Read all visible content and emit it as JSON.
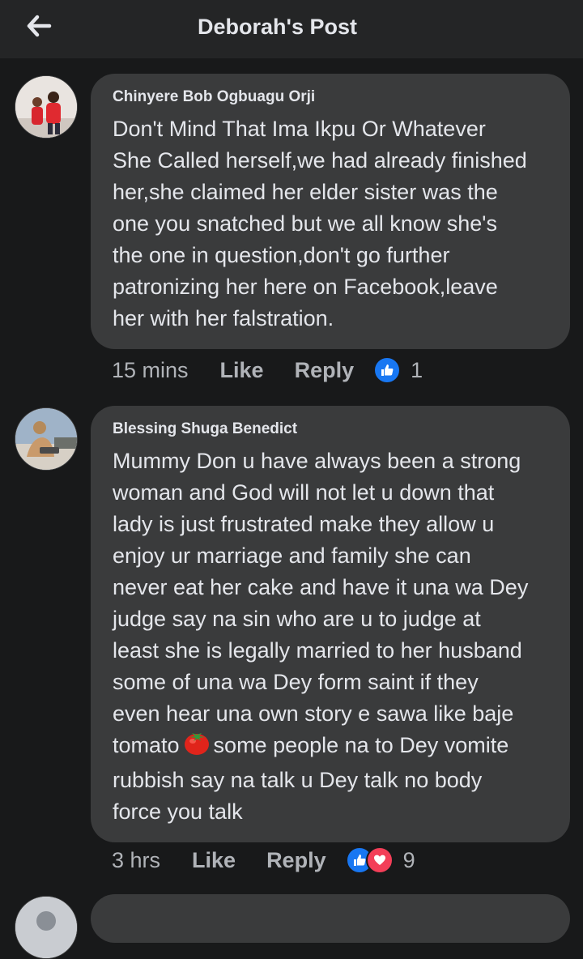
{
  "header": {
    "title": "Deborah's Post",
    "back_icon": "arrow-left-icon"
  },
  "colors": {
    "background": "#18191a",
    "bubble": "#3a3b3c",
    "like_blue": "#1877f2",
    "love_red": "#f33e58"
  },
  "comments": [
    {
      "author": "Chinyere Bob Ogbuagu Orji",
      "text": "Don't Mind That Ima Ikpu Or Whatever\nShe Called herself,we had already finished\nher,she claimed her elder sister was the\none you snatched but we all know she's\nthe one in question,don't go further\npatronizing her here on Facebook,leave\nher with her falstration.",
      "time": "15 mins",
      "like_label": "Like",
      "reply_label": "Reply",
      "reactions": [
        "like"
      ],
      "reaction_count": "1"
    },
    {
      "author": "Blessing Shuga Benedict",
      "text_before_emoji": "Mummy Don u have always been a strong\nwoman and God will not let u down that\nlady is just frustrated make they allow u\nenjoy ur marriage and family she can\nnever eat her cake and have it una wa Dey\njudge say na sin who are u to judge at\nleast she is legally married to her husband\nsome of una wa Dey form saint if they\neven hear una own story e sawa like baje\ntomato",
      "emoji": "tomato-emoji",
      "text_after_emoji": "some people na to Dey vomite\nrubbish say na talk u Dey talk no body\nforce you talk",
      "time": "3 hrs",
      "like_label": "Like",
      "reply_label": "Reply",
      "reactions": [
        "like",
        "love"
      ],
      "reaction_count": "9"
    }
  ]
}
